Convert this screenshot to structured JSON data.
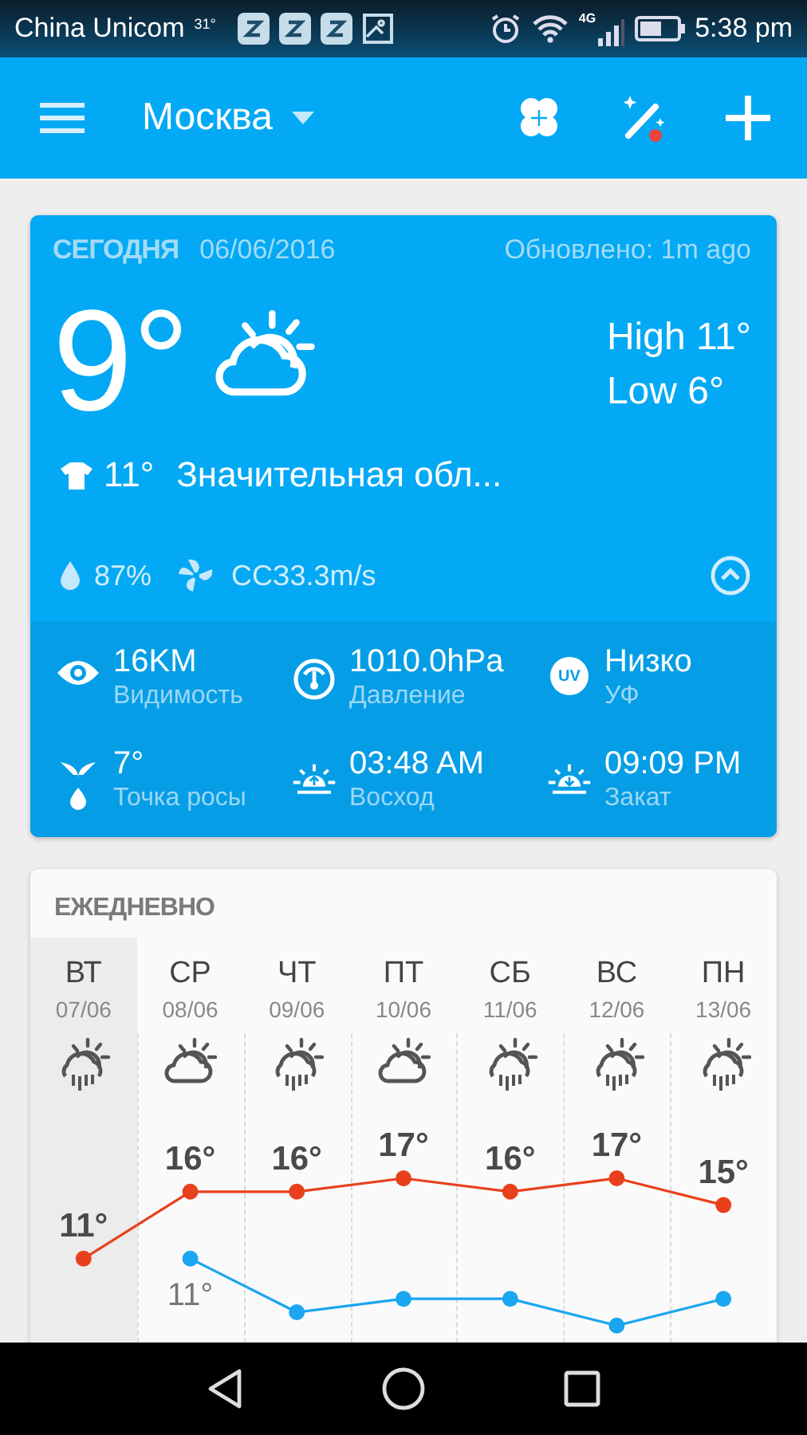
{
  "status_bar": {
    "carrier": "China Unicom",
    "temperature": "31°",
    "network": "4G",
    "time": "5:38 pm"
  },
  "app_bar": {
    "city": "Москва"
  },
  "today": {
    "label": "СЕГОДНЯ",
    "date": "06/06/2016",
    "updated": "Обновлено: 1m ago",
    "temperature": "9°",
    "kind": "partly_cloudy",
    "high": "High 11°",
    "low": "Low 6°",
    "feels_like": "11°",
    "condition": "Значительная обл...",
    "humidity": "87%",
    "wind": "ССЗ3.3m/s",
    "expanded": true,
    "details": [
      {
        "kind": "visibility",
        "value": "16KM",
        "label": "Видимость"
      },
      {
        "kind": "pressure",
        "value": "1010.0hPa",
        "label": "Давление"
      },
      {
        "kind": "uv",
        "badge": "UV",
        "value": "Низко",
        "label": "УФ"
      },
      {
        "kind": "dew_point",
        "value": "7°",
        "label": "Точка росы"
      },
      {
        "kind": "sunrise",
        "value": "03:48 AM",
        "label": "Восход"
      },
      {
        "kind": "sunset",
        "value": "09:09 PM",
        "label": "Закат"
      }
    ]
  },
  "daily": {
    "title": "ЕЖЕДНЕВНО",
    "days": [
      {
        "date": "07/06",
        "kind": "rain",
        "selected": true
      },
      {
        "date": "08/06",
        "kind": "partly_cloudy",
        "selected": false
      },
      {
        "date": "09/06",
        "kind": "rain",
        "selected": false
      },
      {
        "date": "10/06",
        "kind": "partly_cloudy",
        "selected": false
      },
      {
        "date": "11/06",
        "kind": "rain",
        "selected": false
      },
      {
        "date": "12/06",
        "kind": "rain",
        "selected": false
      },
      {
        "date": "13/06",
        "kind": "rain",
        "selected": false
      }
    ],
    "chart_data": {
      "type": "line",
      "categories": [
        "ВТ",
        "СР",
        "ЧТ",
        "ПТ",
        "СБ",
        "ВС",
        "ПН"
      ],
      "series": [
        {
          "color": "#e8401c",
          "marker": "circle",
          "values": [
            11,
            16,
            16,
            17,
            16,
            17,
            15
          ],
          "value_labels": [
            "11°",
            "16°",
            "16°",
            "17°",
            "16°",
            "17°",
            "15°"
          ]
        },
        {
          "color": "#1aa6f0",
          "marker": "circle",
          "values": [
            null,
            11,
            7,
            8,
            8,
            6,
            8
          ],
          "value_labels": [
            null,
            "11°",
            null,
            null,
            null,
            null,
            null
          ]
        }
      ]
    }
  }
}
